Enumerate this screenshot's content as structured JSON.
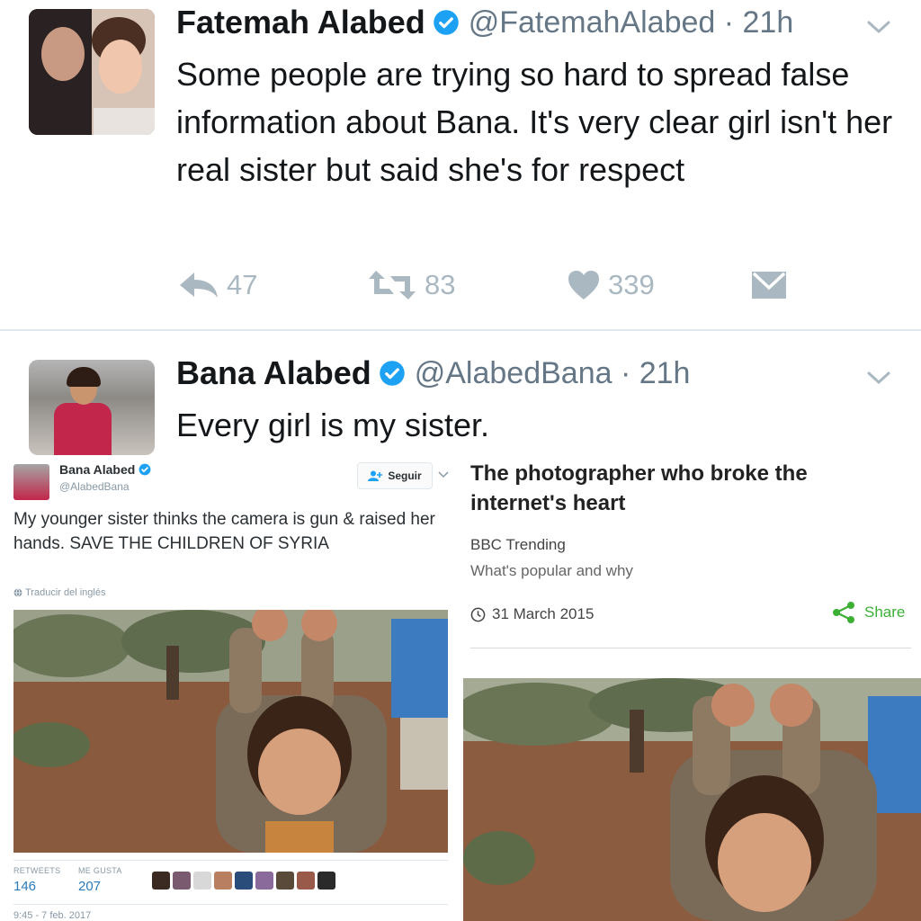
{
  "tweet1": {
    "display_name": "Fatemah Alabed",
    "handle_time": "@FatemahAlabed · 21h",
    "text": "Some people are trying so hard to spread false information about Bana. It's very clear girl isn't her real sister but said she's for respect",
    "replies": "47",
    "retweets": "83",
    "likes": "339"
  },
  "tweet2": {
    "display_name": "Bana Alabed",
    "handle_time": "@AlabedBana · 21h",
    "text": "Every girl is my sister."
  },
  "embedded_tweet": {
    "display_name": "Bana Alabed",
    "handle": "@AlabedBana",
    "follow_label": "Seguir",
    "text": "My younger sister thinks the camera is gun & raised her hands. SAVE THE CHILDREN OF SYRIA",
    "translate_label": "Traducir del inglés",
    "retweets_label": "RETWEETS",
    "retweets_value": "146",
    "likes_label": "ME GUSTA",
    "likes_value": "207",
    "timestamp": "9:45 - 7 feb. 2017"
  },
  "bbc_card": {
    "title": "The photographer who broke the internet's heart",
    "source": "BBC Trending",
    "tagline": "What's popular and why",
    "date": "31 March 2015",
    "share_label": "Share"
  },
  "colors": {
    "verified_blue": "#1da1f2",
    "action_gray": "#aab8c2",
    "link_blue": "#2b7bb9",
    "share_green": "#3cb034"
  },
  "icons": {
    "reply": "reply-icon",
    "retweet": "retweet-icon",
    "like": "heart-icon",
    "dm": "envelope-icon",
    "verified": "verified-badge-icon",
    "caret": "chevron-down-icon",
    "globe": "globe-icon",
    "clock": "clock-icon",
    "share": "share-icon",
    "follow": "follow-user-icon"
  }
}
